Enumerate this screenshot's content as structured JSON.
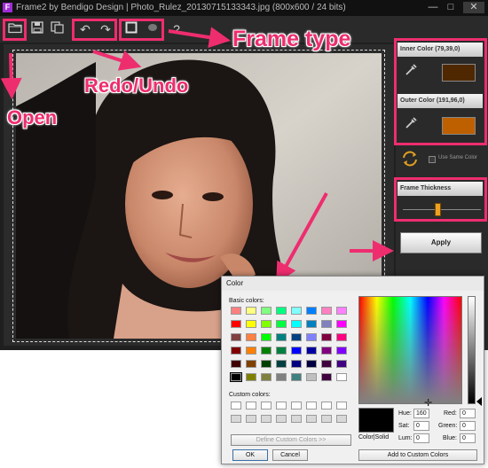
{
  "window": {
    "app_letter": "F",
    "title": "Frame2 by Bendigo Design | Photo_Rulez_20130715133343.jpg (800x600 / 24 bits)",
    "min_glyph": "—",
    "max_glyph": "□",
    "close_glyph": "✕"
  },
  "toolbar": {
    "icons": [
      "open-folder-icon",
      "save-icon",
      "copy-icon",
      "undo-icon",
      "redo-icon",
      "square-frame-icon",
      "oval-frame-icon",
      "help-icon"
    ],
    "help_glyph": "?",
    "undo_glyph": "↶",
    "redo_glyph": "↷"
  },
  "side": {
    "inner_color_label": "Inner Color (79,39,0)",
    "inner_color": "#4f2700",
    "outer_color_label": "Outer Color (191,96,0)",
    "outer_color": "#bf6000",
    "use_same_color_label": "Use Same Color",
    "frame_thickness_label": "Frame Thickness",
    "apply_label": "Apply"
  },
  "callouts": {
    "frame_type": "Frame type",
    "redo_undo": "Redo/Undo",
    "open": "Open",
    "color": "#ee2d6f"
  },
  "dialog": {
    "title": "Color",
    "basic_colors_label": "Basic colors:",
    "custom_colors_label": "Custom colors:",
    "define_custom_label": "Define Custom Colors >>",
    "ok_label": "OK",
    "cancel_label": "Cancel",
    "add_custom_label": "Add to Custom Colors",
    "color_solid_label": "Color|Solid",
    "hue_label": "Hue:",
    "hue_value": "160",
    "sat_label": "Sat:",
    "sat_value": "0",
    "lum_label": "Lum:",
    "lum_value": "0",
    "red_label": "Red:",
    "red_value": "0",
    "green_label": "Green:",
    "green_value": "0",
    "blue_label": "Blue:",
    "blue_value": "0",
    "basic_colors": [
      [
        "#ff8080",
        "#ffff80",
        "#80ff80",
        "#00ff80",
        "#80ffff",
        "#0080ff",
        "#ff80c0",
        "#ff80ff"
      ],
      [
        "#ff0000",
        "#ffff00",
        "#80ff00",
        "#00ff40",
        "#00ffff",
        "#0080c0",
        "#8080c0",
        "#ff00ff"
      ],
      [
        "#804040",
        "#ff8040",
        "#00ff00",
        "#008080",
        "#004080",
        "#8080ff",
        "#800040",
        "#ff0080"
      ],
      [
        "#800000",
        "#ff8000",
        "#008000",
        "#008040",
        "#0000ff",
        "#0000a0",
        "#800080",
        "#8000ff"
      ],
      [
        "#400000",
        "#804000",
        "#004000",
        "#004040",
        "#000080",
        "#000040",
        "#400040",
        "#400080"
      ],
      [
        "#000000",
        "#808000",
        "#808040",
        "#808080",
        "#408080",
        "#c0c0c0",
        "#400040",
        "#ffffff"
      ]
    ],
    "selected_basic": "#000000"
  }
}
